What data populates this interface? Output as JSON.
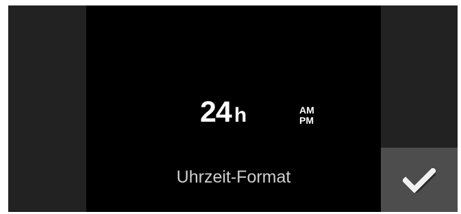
{
  "screen": {
    "title": "Uhrzeit-Format"
  },
  "options": {
    "hour24": {
      "number": "24",
      "unit": "h"
    },
    "hour12": {
      "am": "AM",
      "pm": "PM"
    }
  },
  "actions": {
    "confirm_icon": "checkmark-icon"
  },
  "colors": {
    "background": "#000000",
    "side_panel": "#222222",
    "confirm_button": "#4d4d4d",
    "text_primary": "#ffffff",
    "text_secondary": "#cfcfcf"
  }
}
